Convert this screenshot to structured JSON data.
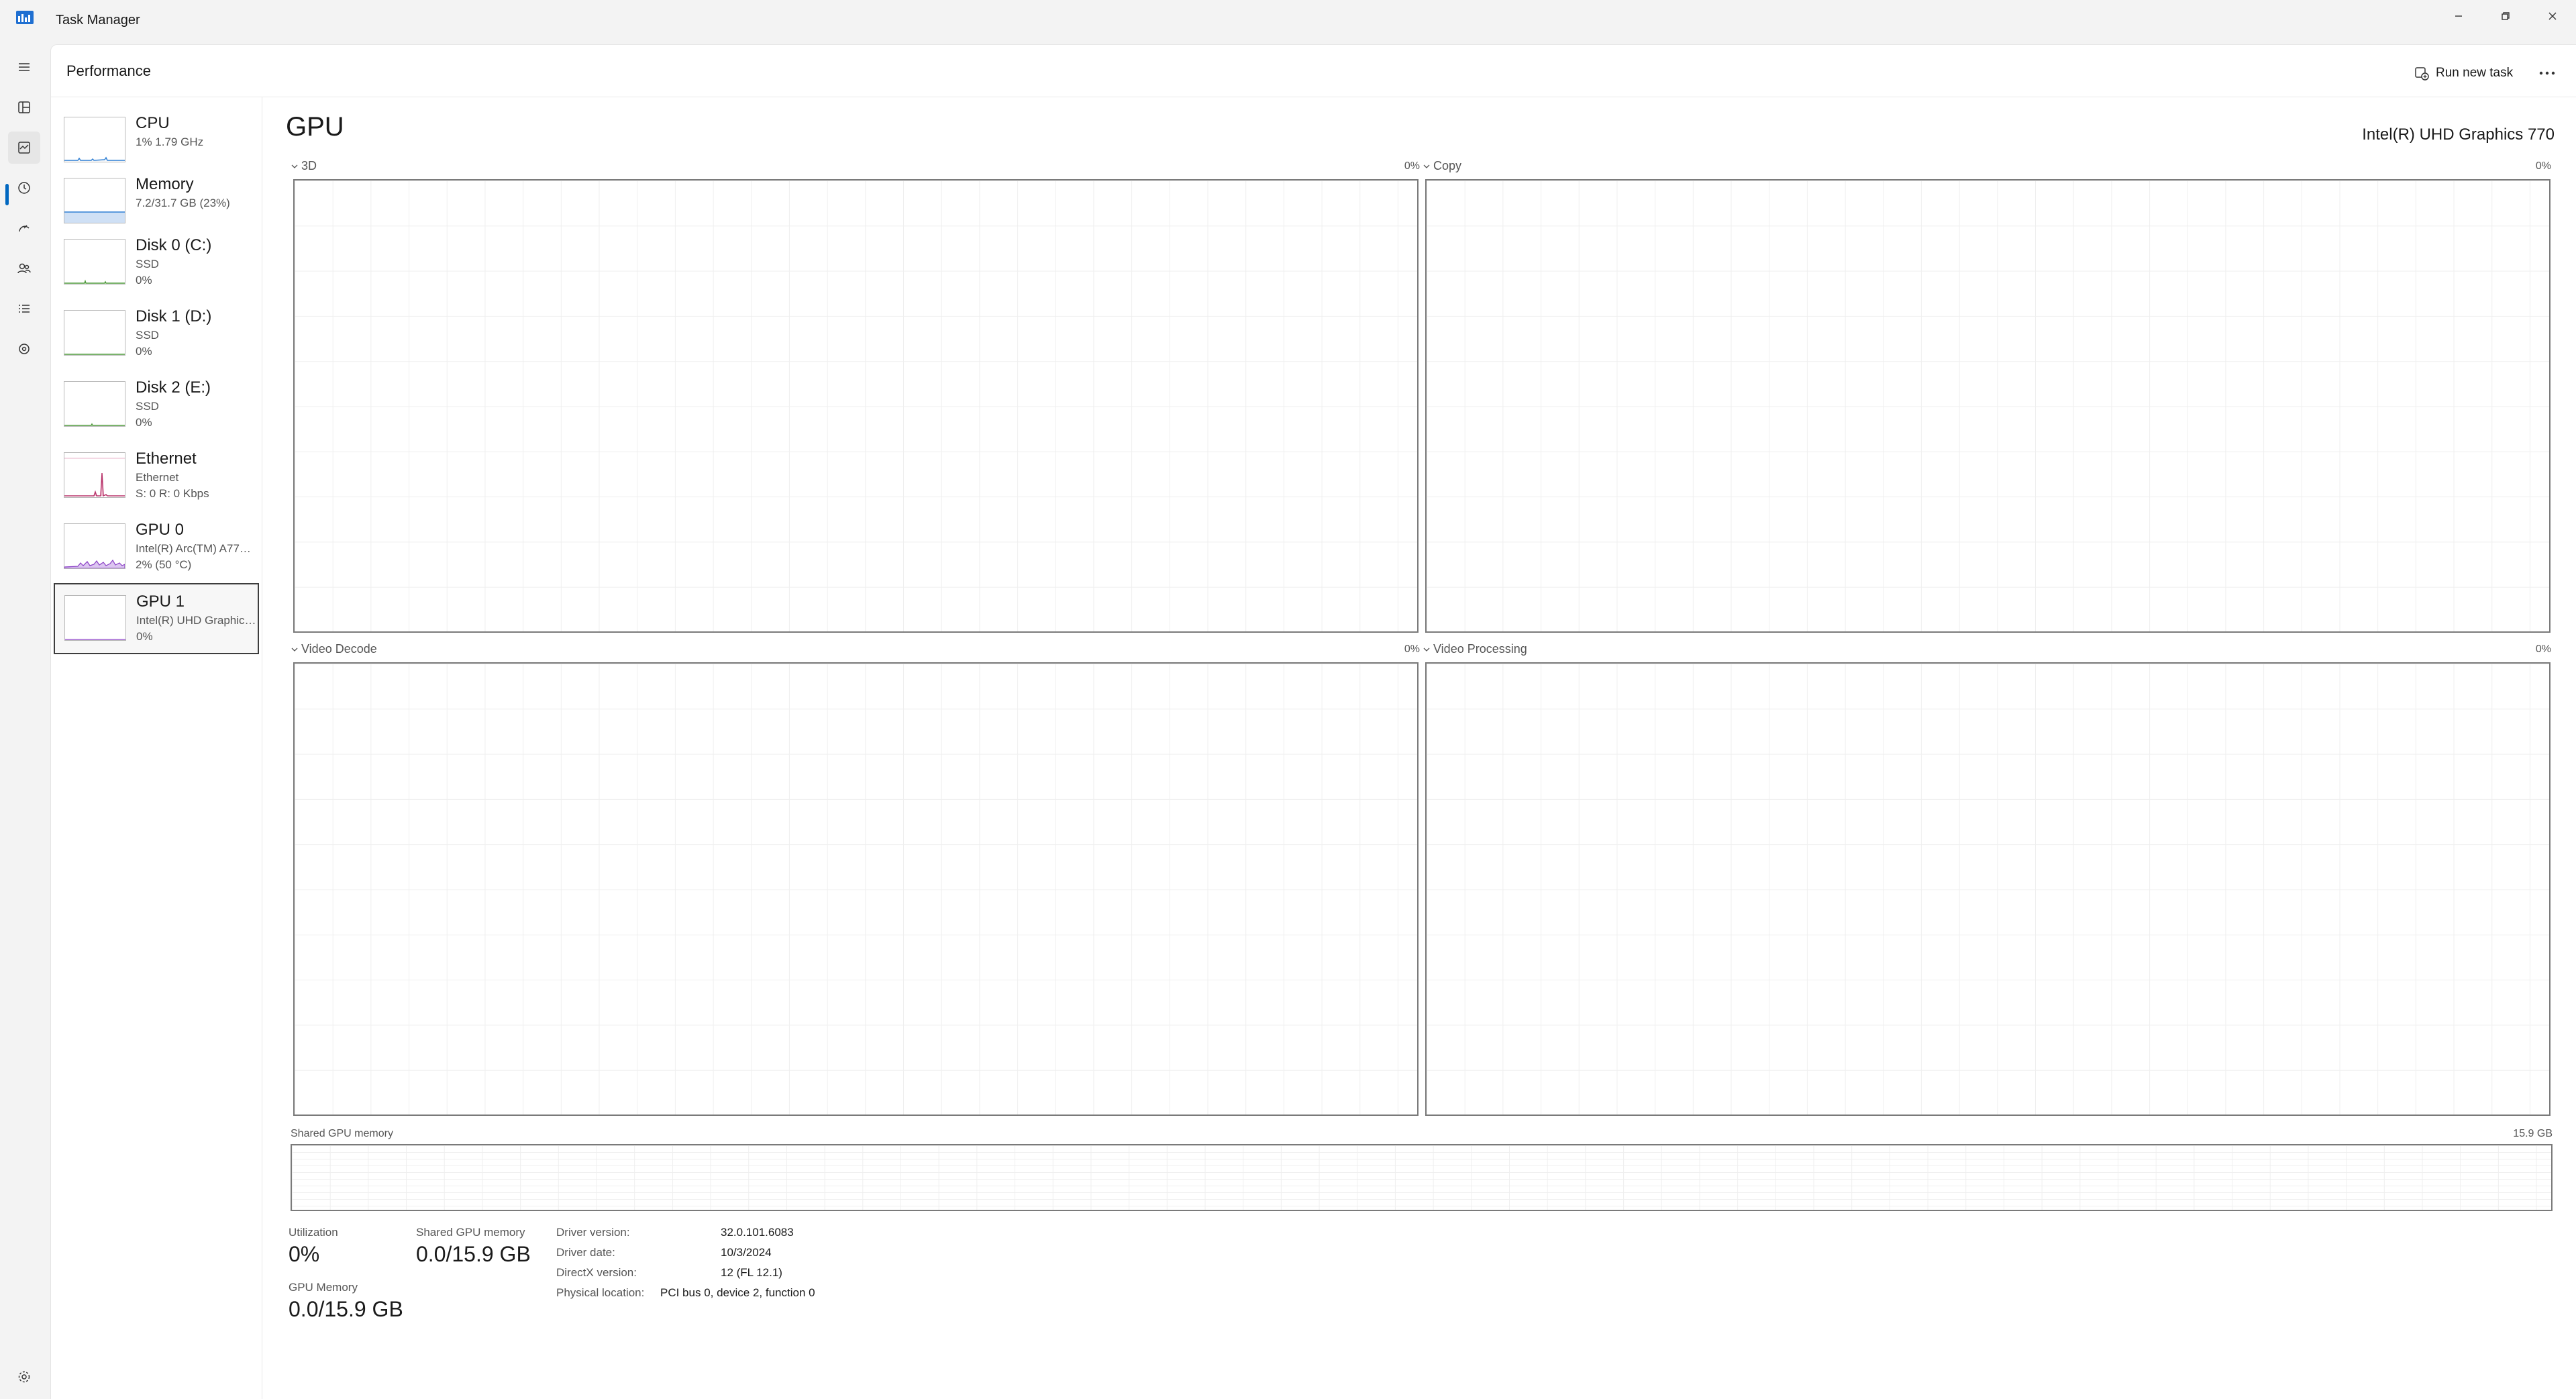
{
  "window": {
    "title": "Task Manager"
  },
  "header": {
    "title": "Performance",
    "run_new_task": "Run new task",
    "more_icon": "more-icon"
  },
  "resources": [
    {
      "name": "CPU",
      "line1": "1%  1.79 GHz",
      "line2": ""
    },
    {
      "name": "Memory",
      "line1": "7.2/31.7 GB (23%)",
      "line2": ""
    },
    {
      "name": "Disk 0 (C:)",
      "line1": "SSD",
      "line2": "0%"
    },
    {
      "name": "Disk 1 (D:)",
      "line1": "SSD",
      "line2": "0%"
    },
    {
      "name": "Disk 2 (E:)",
      "line1": "SSD",
      "line2": "0%"
    },
    {
      "name": "Ethernet",
      "line1": "Ethernet",
      "line2": "S: 0  R: 0 Kbps"
    },
    {
      "name": "GPU 0",
      "line1": "Intel(R) Arc(TM) A770 ...",
      "line2": "2%  (50 °C)"
    },
    {
      "name": "GPU 1",
      "line1": "Intel(R) UHD Graphics ...",
      "line2": "0%",
      "selected": true
    }
  ],
  "detail": {
    "title": "GPU",
    "device": "Intel(R) UHD Graphics 770",
    "engines": [
      {
        "label": "3D",
        "pct": "0%"
      },
      {
        "label": "Copy",
        "pct": "0%"
      },
      {
        "label": "Video Decode",
        "pct": "0%"
      },
      {
        "label": "Video Processing",
        "pct": "0%"
      }
    ],
    "shared_memory_graph": {
      "label": "Shared GPU memory",
      "max": "15.9 GB"
    },
    "stats": {
      "utilization_label": "Utilization",
      "utilization_value": "0%",
      "shared_label": "Shared GPU memory",
      "shared_value": "0.0/15.9 GB",
      "gpu_mem_label": "GPU Memory",
      "gpu_mem_value": "0.0/15.9 GB"
    },
    "info": {
      "driver_version_label": "Driver version:",
      "driver_version": "32.0.101.6083",
      "driver_date_label": "Driver date:",
      "driver_date": "10/3/2024",
      "directx_label": "DirectX version:",
      "directx": "12 (FL 12.1)",
      "location_label": "Physical location:",
      "location": "PCI bus 0, device 2, function 0"
    }
  },
  "colors": {
    "accent": "#0067c0",
    "cpu": "#2f7fd3",
    "memory": "#7aa7dc",
    "disk": "#4f9a3c",
    "ethernet": "#b8336a",
    "gpu": "#8a3fc6"
  },
  "icons": [
    "hamburger-icon",
    "processes-icon",
    "performance-icon",
    "app-history-icon",
    "startup-apps-icon",
    "users-icon",
    "details-icon",
    "services-icon",
    "settings-icon"
  ]
}
